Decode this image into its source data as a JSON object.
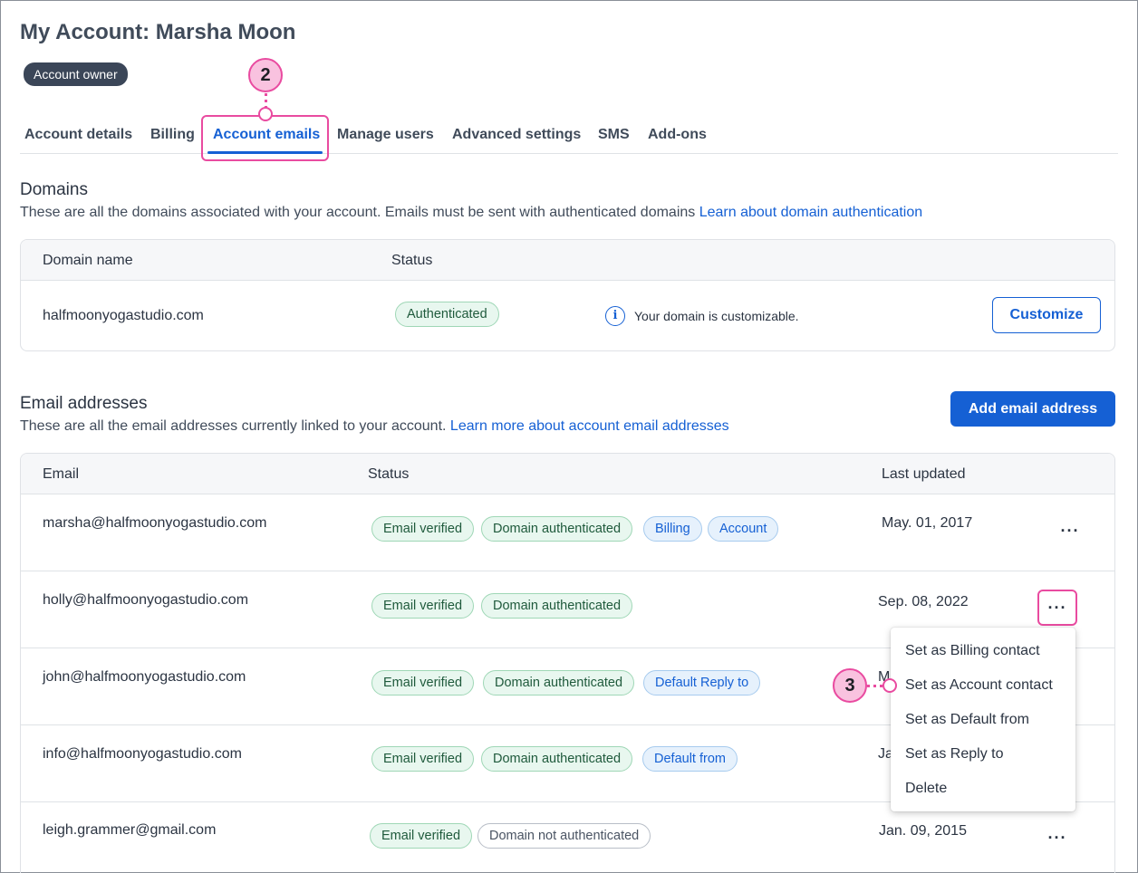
{
  "header": {
    "title": "My Account: Marsha Moon",
    "role_badge": "Account owner"
  },
  "tabs": [
    {
      "label": "Account details"
    },
    {
      "label": "Billing"
    },
    {
      "label": "Account emails",
      "active": true
    },
    {
      "label": "Manage users"
    },
    {
      "label": "Advanced settings"
    },
    {
      "label": "SMS"
    },
    {
      "label": "Add-ons"
    }
  ],
  "callouts": {
    "tab_step": "2",
    "menu_step": "3",
    "color": "#e94ba0"
  },
  "domains": {
    "title": "Domains",
    "description": "These are all the domains associated with your account. Emails must be sent with authenticated domains",
    "link": "Learn about domain authentication",
    "headers": {
      "name": "Domain name",
      "status": "Status"
    },
    "rows": [
      {
        "name": "halfmoonyogastudio.com",
        "status": "Authenticated",
        "note": "Your domain is customizable.",
        "action": "Customize",
        "info_icon": "info-icon"
      }
    ]
  },
  "emails": {
    "title": "Email addresses",
    "description": "These are all the email addresses currently linked to your account.",
    "link": "Learn more about account email addresses",
    "add_button": "Add email address",
    "headers": {
      "email": "Email",
      "status": "Status",
      "updated": "Last updated"
    },
    "more_label": "···",
    "rows": [
      {
        "email": "marsha@halfmoonyogastudio.com",
        "badges": [
          "Email verified",
          "Domain authenticated",
          "Billing",
          "Account"
        ],
        "updated": "May. 01, 2017"
      },
      {
        "email": "holly@halfmoonyogastudio.com",
        "badges": [
          "Email verified",
          "Domain authenticated"
        ],
        "updated": "Sep. 08, 2022"
      },
      {
        "email": "john@halfmoonyogastudio.com",
        "badges": [
          "Email verified",
          "Domain authenticated",
          "Default Reply to"
        ],
        "updated": "M"
      },
      {
        "email": "info@halfmoonyogastudio.com",
        "badges": [
          "Email verified",
          "Domain authenticated",
          "Default from"
        ],
        "updated": "Ja"
      },
      {
        "email": "leigh.grammer@gmail.com",
        "badges": [
          "Email verified",
          "Domain not authenticated"
        ],
        "updated": "Jan. 09, 2015"
      }
    ]
  },
  "context_menu": {
    "items": [
      "Set as Billing contact",
      "Set as Account contact",
      "Set as Default from",
      "Set as Reply to",
      "Delete"
    ]
  },
  "colors": {
    "accent": "#1560d4",
    "verified_bg": "#e8f7ef",
    "info_bg": "#e6f1fc"
  }
}
